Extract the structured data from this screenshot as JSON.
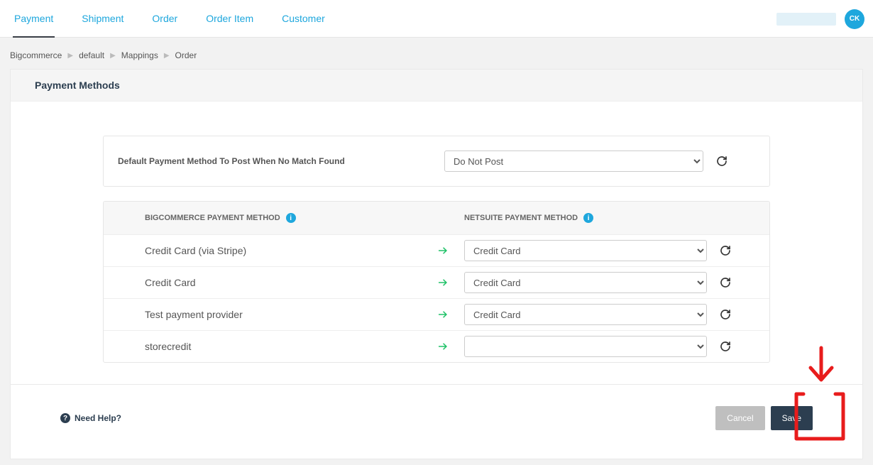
{
  "header": {
    "tabs": [
      "Payment",
      "Shipment",
      "Order",
      "Order Item",
      "Customer"
    ],
    "avatar_initials": "CK"
  },
  "breadcrumbs": [
    "Bigcommerce",
    "default",
    "Mappings",
    "Order"
  ],
  "section_title": "Payment Methods",
  "default_row": {
    "label": "Default Payment Method To Post When No Match Found",
    "selected": "Do Not Post"
  },
  "columns": {
    "bc": "BIGCOMMERCE PAYMENT METHOD",
    "ns": "NETSUITE PAYMENT METHOD"
  },
  "rows": [
    {
      "bc": "Credit Card (via Stripe)",
      "ns": "Credit Card"
    },
    {
      "bc": "Credit Card",
      "ns": "Credit Card"
    },
    {
      "bc": "Test payment provider",
      "ns": "Credit Card"
    },
    {
      "bc": "storecredit",
      "ns": ""
    }
  ],
  "footer": {
    "help": "Need Help?",
    "cancel": "Cancel",
    "save": "Save"
  }
}
